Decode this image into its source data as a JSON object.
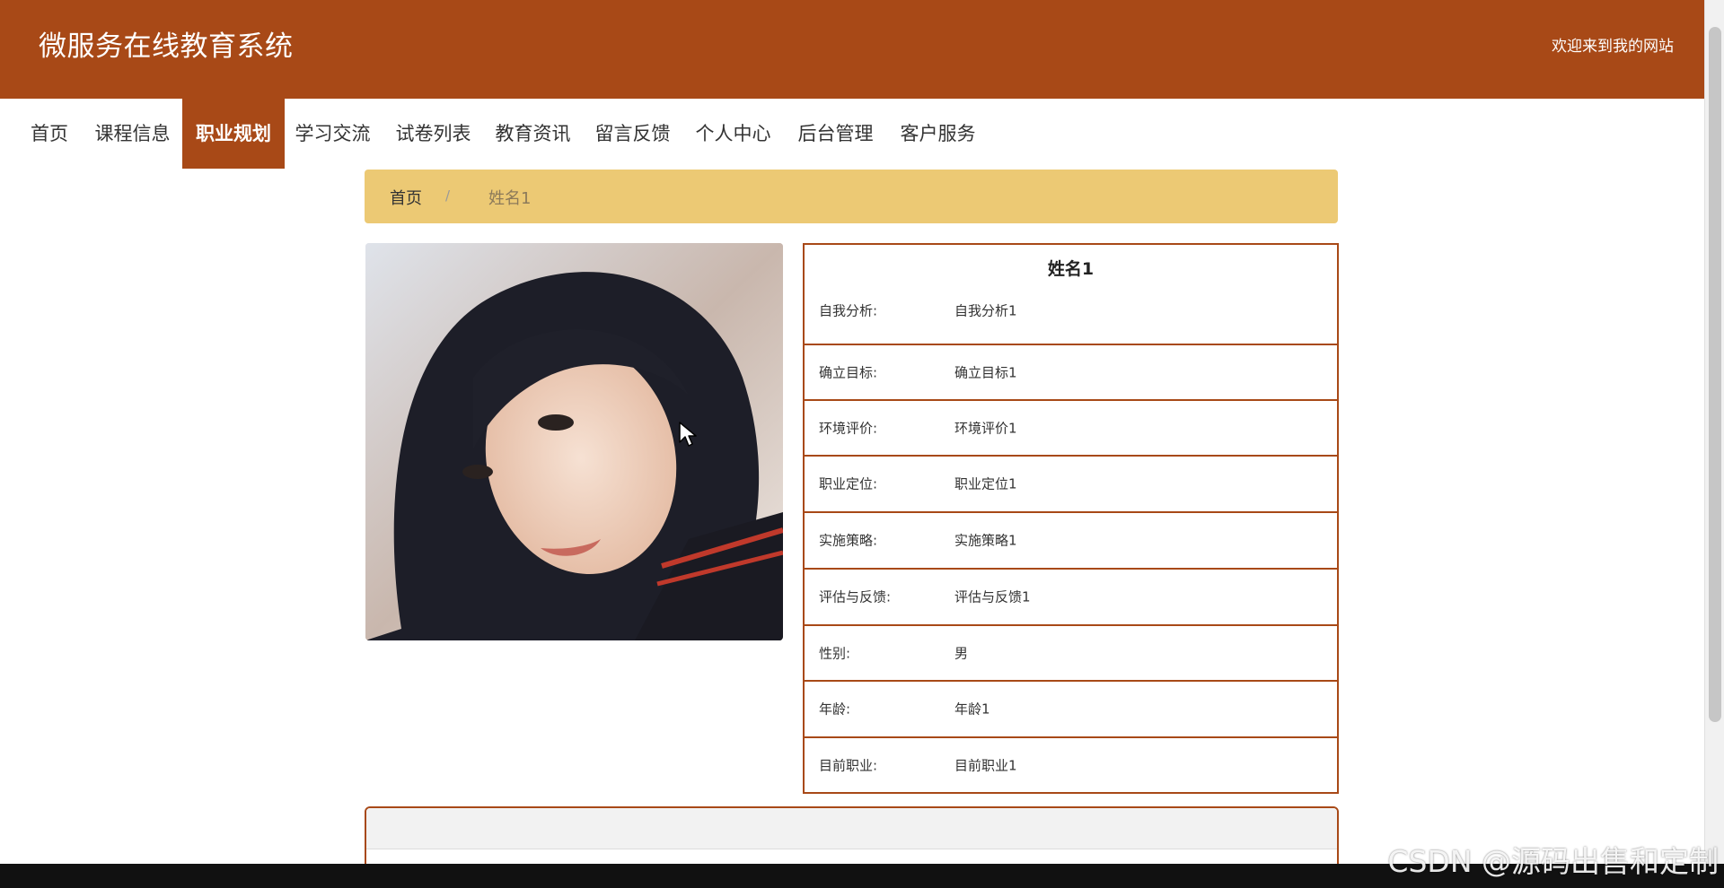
{
  "header": {
    "site_title": "微服务在线教育系统",
    "welcome": "欢迎来到我的网站"
  },
  "nav": {
    "items": [
      {
        "label": "首页"
      },
      {
        "label": "课程信息"
      },
      {
        "label": "职业规划",
        "active": true
      },
      {
        "label": "学习交流"
      },
      {
        "label": "试卷列表"
      },
      {
        "label": "教育资讯"
      },
      {
        "label": "留言反馈"
      },
      {
        "label": "个人中心"
      },
      {
        "label": "后台管理"
      },
      {
        "label": "客户服务"
      }
    ]
  },
  "breadcrumb": {
    "home": "首页",
    "separator": "/",
    "current": "姓名1"
  },
  "detail": {
    "name": "姓名1",
    "rows": [
      {
        "label": "自我分析:",
        "value": "自我分析1"
      },
      {
        "label": "确立目标:",
        "value": "确立目标1"
      },
      {
        "label": "环境评价:",
        "value": "环境评价1"
      },
      {
        "label": "职业定位:",
        "value": "职业定位1"
      },
      {
        "label": "实施策略:",
        "value": "实施策略1"
      },
      {
        "label": "评估与反馈:",
        "value": "评估与反馈1"
      },
      {
        "label": "性别:",
        "value": "男"
      },
      {
        "label": "年龄:",
        "value": "年龄1"
      },
      {
        "label": "目前职业:",
        "value": "目前职业1"
      }
    ]
  },
  "watermark": "CSDN @源码出售和定制",
  "colors": {
    "primary": "#a84917",
    "breadcrumb_bg": "#ecc974"
  }
}
